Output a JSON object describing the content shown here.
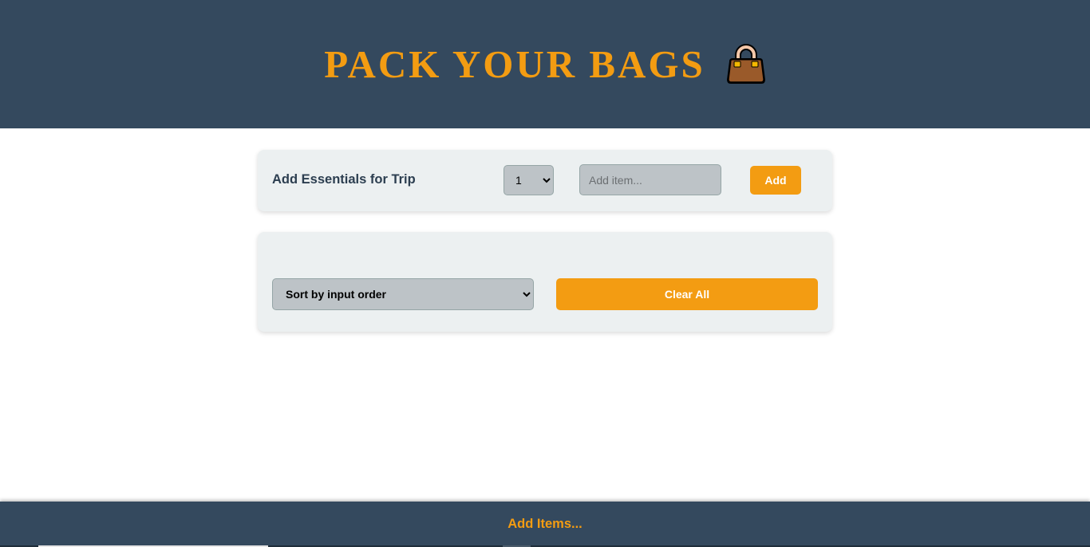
{
  "header": {
    "title": "PACK YOUR BAGS",
    "icon": "handbag-icon"
  },
  "add_form": {
    "label": "Add Essentials for Trip",
    "quantity_selected": "1",
    "item_placeholder": "Add item...",
    "item_value": "",
    "add_button_label": "Add"
  },
  "list_controls": {
    "sort_selected": "Sort by input order",
    "clear_button_label": "Clear All"
  },
  "footer": {
    "text": "Add Items..."
  },
  "colors": {
    "header_bg": "#34495e",
    "accent": "#f39c12",
    "card_bg": "#ecf0f1",
    "input_bg": "#bdc3c7",
    "label_text": "#2c3e50"
  }
}
